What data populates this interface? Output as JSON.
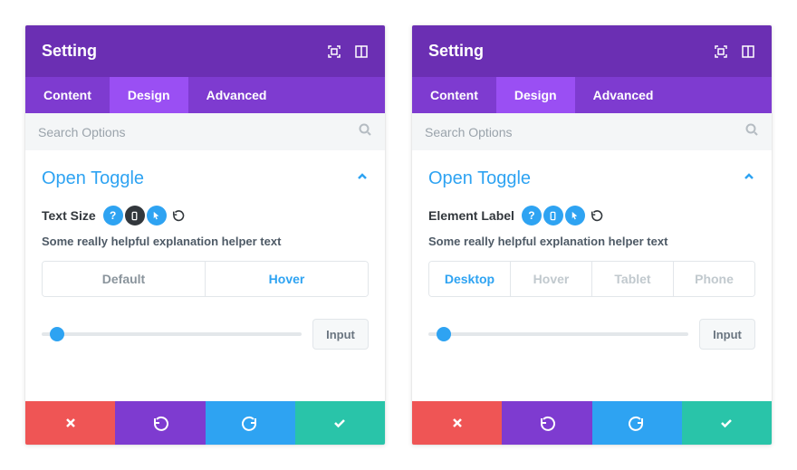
{
  "panels": [
    {
      "title": "Setting",
      "tabs": {
        "content": "Content",
        "design": "Design",
        "advanced": "Advanced",
        "active": "design"
      },
      "search_placeholder": "Search Options",
      "section_title": "Open Toggle",
      "field_label": "Text Size",
      "helper": "Some really helpful explanation helper text",
      "segments": [
        {
          "label": "Default",
          "state": "mid"
        },
        {
          "label": "Hover",
          "state": "active"
        }
      ],
      "slider_input": "Input",
      "label_pills": [
        "help",
        "device",
        "cursor"
      ],
      "device_pill_active": false
    },
    {
      "title": "Setting",
      "tabs": {
        "content": "Content",
        "design": "Design",
        "advanced": "Advanced",
        "active": "design"
      },
      "search_placeholder": "Search Options",
      "section_title": "Open Toggle",
      "field_label": "Element Label",
      "helper": "Some really helpful explanation helper text",
      "segments": [
        {
          "label": "Desktop",
          "state": "active"
        },
        {
          "label": "Hover",
          "state": "dim"
        },
        {
          "label": "Tablet",
          "state": "dim"
        },
        {
          "label": "Phone",
          "state": "dim"
        }
      ],
      "slider_input": "Input",
      "label_pills": [
        "help",
        "device",
        "cursor"
      ],
      "device_pill_active": true
    }
  ]
}
